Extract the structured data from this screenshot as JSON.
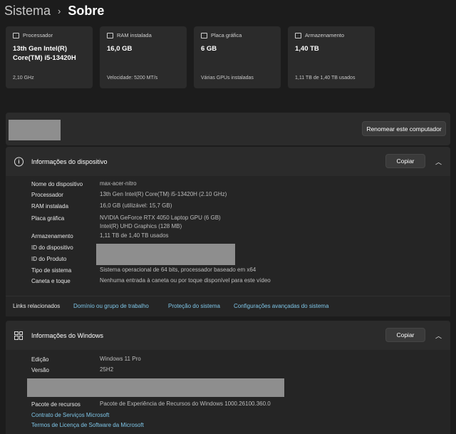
{
  "breadcrumb": {
    "root": "Sistema",
    "separator": "›",
    "current": "Sobre"
  },
  "cards": [
    {
      "label": "Processador",
      "value": "13th Gen Intel(R) Core(TM) i5-13420H",
      "sub": "2,10 GHz",
      "icon": "processor-icon"
    },
    {
      "label": "RAM instalada",
      "value": "16,0 GB",
      "sub": "Velocidade: 5200 MT/s",
      "icon": "ram-icon"
    },
    {
      "label": "Placa gráfica",
      "value": "6 GB",
      "sub": "Várias GPUs instaladas",
      "icon": "gpu-icon"
    },
    {
      "label": "Armazenamento",
      "value": "1,40 TB",
      "sub": "1,11 TB de 1,40 TB usados",
      "icon": "storage-icon"
    }
  ],
  "rename_button": "Renomear este computador",
  "device_info": {
    "title": "Informações do dispositivo",
    "copy_label": "Copiar",
    "rows": [
      {
        "label": "Nome do dispositivo",
        "value": "max-acer-nitro"
      },
      {
        "label": "Processador",
        "value": "13th Gen Intel(R) Core(TM) i5-13420H (2.10 GHz)"
      },
      {
        "label": "RAM instalada",
        "value": "16,0 GB (utilizável: 15,7 GB)"
      },
      {
        "label": "Placa gráfica",
        "value": "NVIDIA GeForce RTX 4050 Laptop GPU (6 GB)",
        "value2": "Intel(R) UHD Graphics (128 MB)"
      },
      {
        "label": "Armazenamento",
        "value": "1,11 TB de 1,40 TB usados"
      },
      {
        "label": "ID do dispositivo",
        "value": ""
      },
      {
        "label": "ID do Produto",
        "value": ""
      },
      {
        "label": "Tipo de sistema",
        "value": "Sistema operacional de 64 bits, processador baseado em x64"
      },
      {
        "label": "Caneta e toque",
        "value": "Nenhuma entrada à caneta ou por toque disponível para este vídeo"
      }
    ]
  },
  "related_links": {
    "label": "Links relacionados",
    "links": [
      "Domínio ou grupo de trabalho",
      "Proteção do sistema",
      "Configurações avançadas do sistema"
    ]
  },
  "windows_info": {
    "title": "Informações do Windows",
    "copy_label": "Copiar",
    "rows": [
      {
        "label": "Edição",
        "value": "Windows 11 Pro"
      },
      {
        "label": "Versão",
        "value": "25H2"
      },
      {
        "label": "Pacote de recursos",
        "value": "Pacote de Experiência de Recursos do Windows 1000.26100.360.0"
      }
    ],
    "links": [
      "Contrato de Serviços Microsoft",
      "Termos de Licença de Software da Microsoft"
    ]
  },
  "colors": {
    "background": "#1c1c1c",
    "card": "#2b2b2b",
    "link": "#7fc6e8",
    "redaction": "#8e8e8e"
  }
}
